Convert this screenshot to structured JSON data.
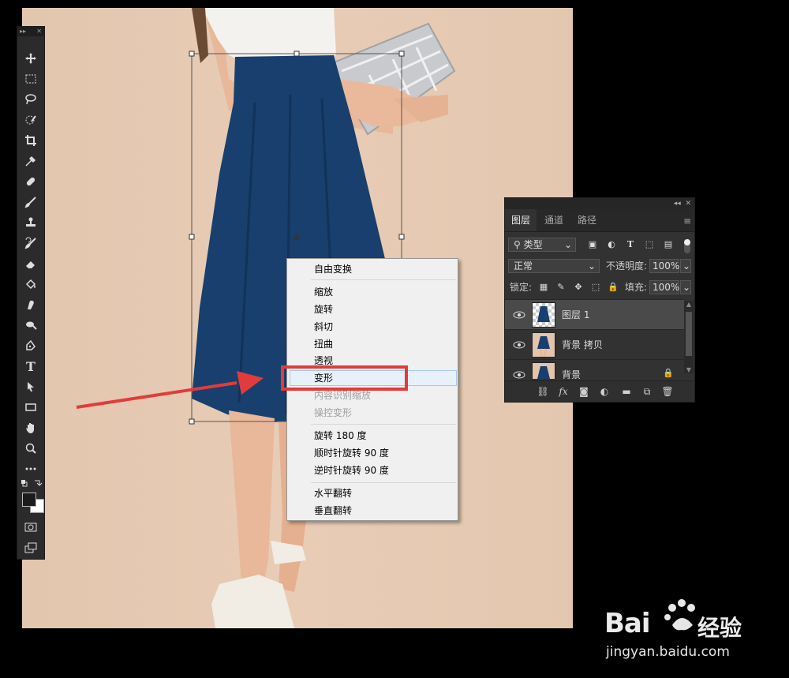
{
  "context_menu": {
    "items": [
      {
        "label": "自由变换",
        "enabled": true
      },
      {
        "label": "缩放",
        "enabled": true
      },
      {
        "label": "旋转",
        "enabled": true
      },
      {
        "label": "斜切",
        "enabled": true
      },
      {
        "label": "扭曲",
        "enabled": true
      },
      {
        "label": "透视",
        "enabled": true
      },
      {
        "label": "变形",
        "enabled": true,
        "highlighted": true
      },
      {
        "label": "内容识别缩放",
        "enabled": false
      },
      {
        "label": "操控变形",
        "enabled": false
      },
      {
        "label": "旋转 180 度",
        "enabled": true
      },
      {
        "label": "顺时针旋转 90 度",
        "enabled": true
      },
      {
        "label": "逆时针旋转 90 度",
        "enabled": true
      },
      {
        "label": "水平翻转",
        "enabled": true
      },
      {
        "label": "垂直翻转",
        "enabled": true
      }
    ]
  },
  "layers_panel": {
    "tabs": [
      "图层",
      "通道",
      "路径"
    ],
    "active_tab": "图层",
    "filter_kind": "类型",
    "blend_mode": "正常",
    "opacity_label": "不透明度:",
    "opacity_value": "100%",
    "lock_label": "锁定:",
    "fill_label": "填充:",
    "fill_value": "100%",
    "layers": [
      {
        "name": "图层 1",
        "selected": true,
        "transparent_thumb": true
      },
      {
        "name": "背景 拷贝",
        "selected": false
      },
      {
        "name": "背景",
        "selected": false,
        "locked": true
      }
    ]
  },
  "toolbar": {
    "tools": [
      "move-tool",
      "marquee-tool",
      "lasso-tool",
      "quick-select-tool",
      "crop-tool",
      "eyedropper-tool",
      "healing-brush-tool",
      "brush-tool",
      "stamp-tool",
      "history-brush-tool",
      "eraser-tool",
      "paint-bucket-tool",
      "smudge-tool",
      "dodge-tool",
      "pen-tool",
      "type-tool",
      "path-select-tool",
      "rectangle-tool",
      "hand-tool",
      "zoom-tool",
      "more-tools"
    ],
    "type_glyph": "T"
  },
  "watermark": {
    "brand": "Bai",
    "brand_cn": "经验",
    "url": "jingyan.baidu.com"
  },
  "colors": {
    "highlight_red": "#e23b3b",
    "skirt_navy": "#183f6e",
    "backdrop": "#e6caB3",
    "panel_bg": "#323232"
  }
}
